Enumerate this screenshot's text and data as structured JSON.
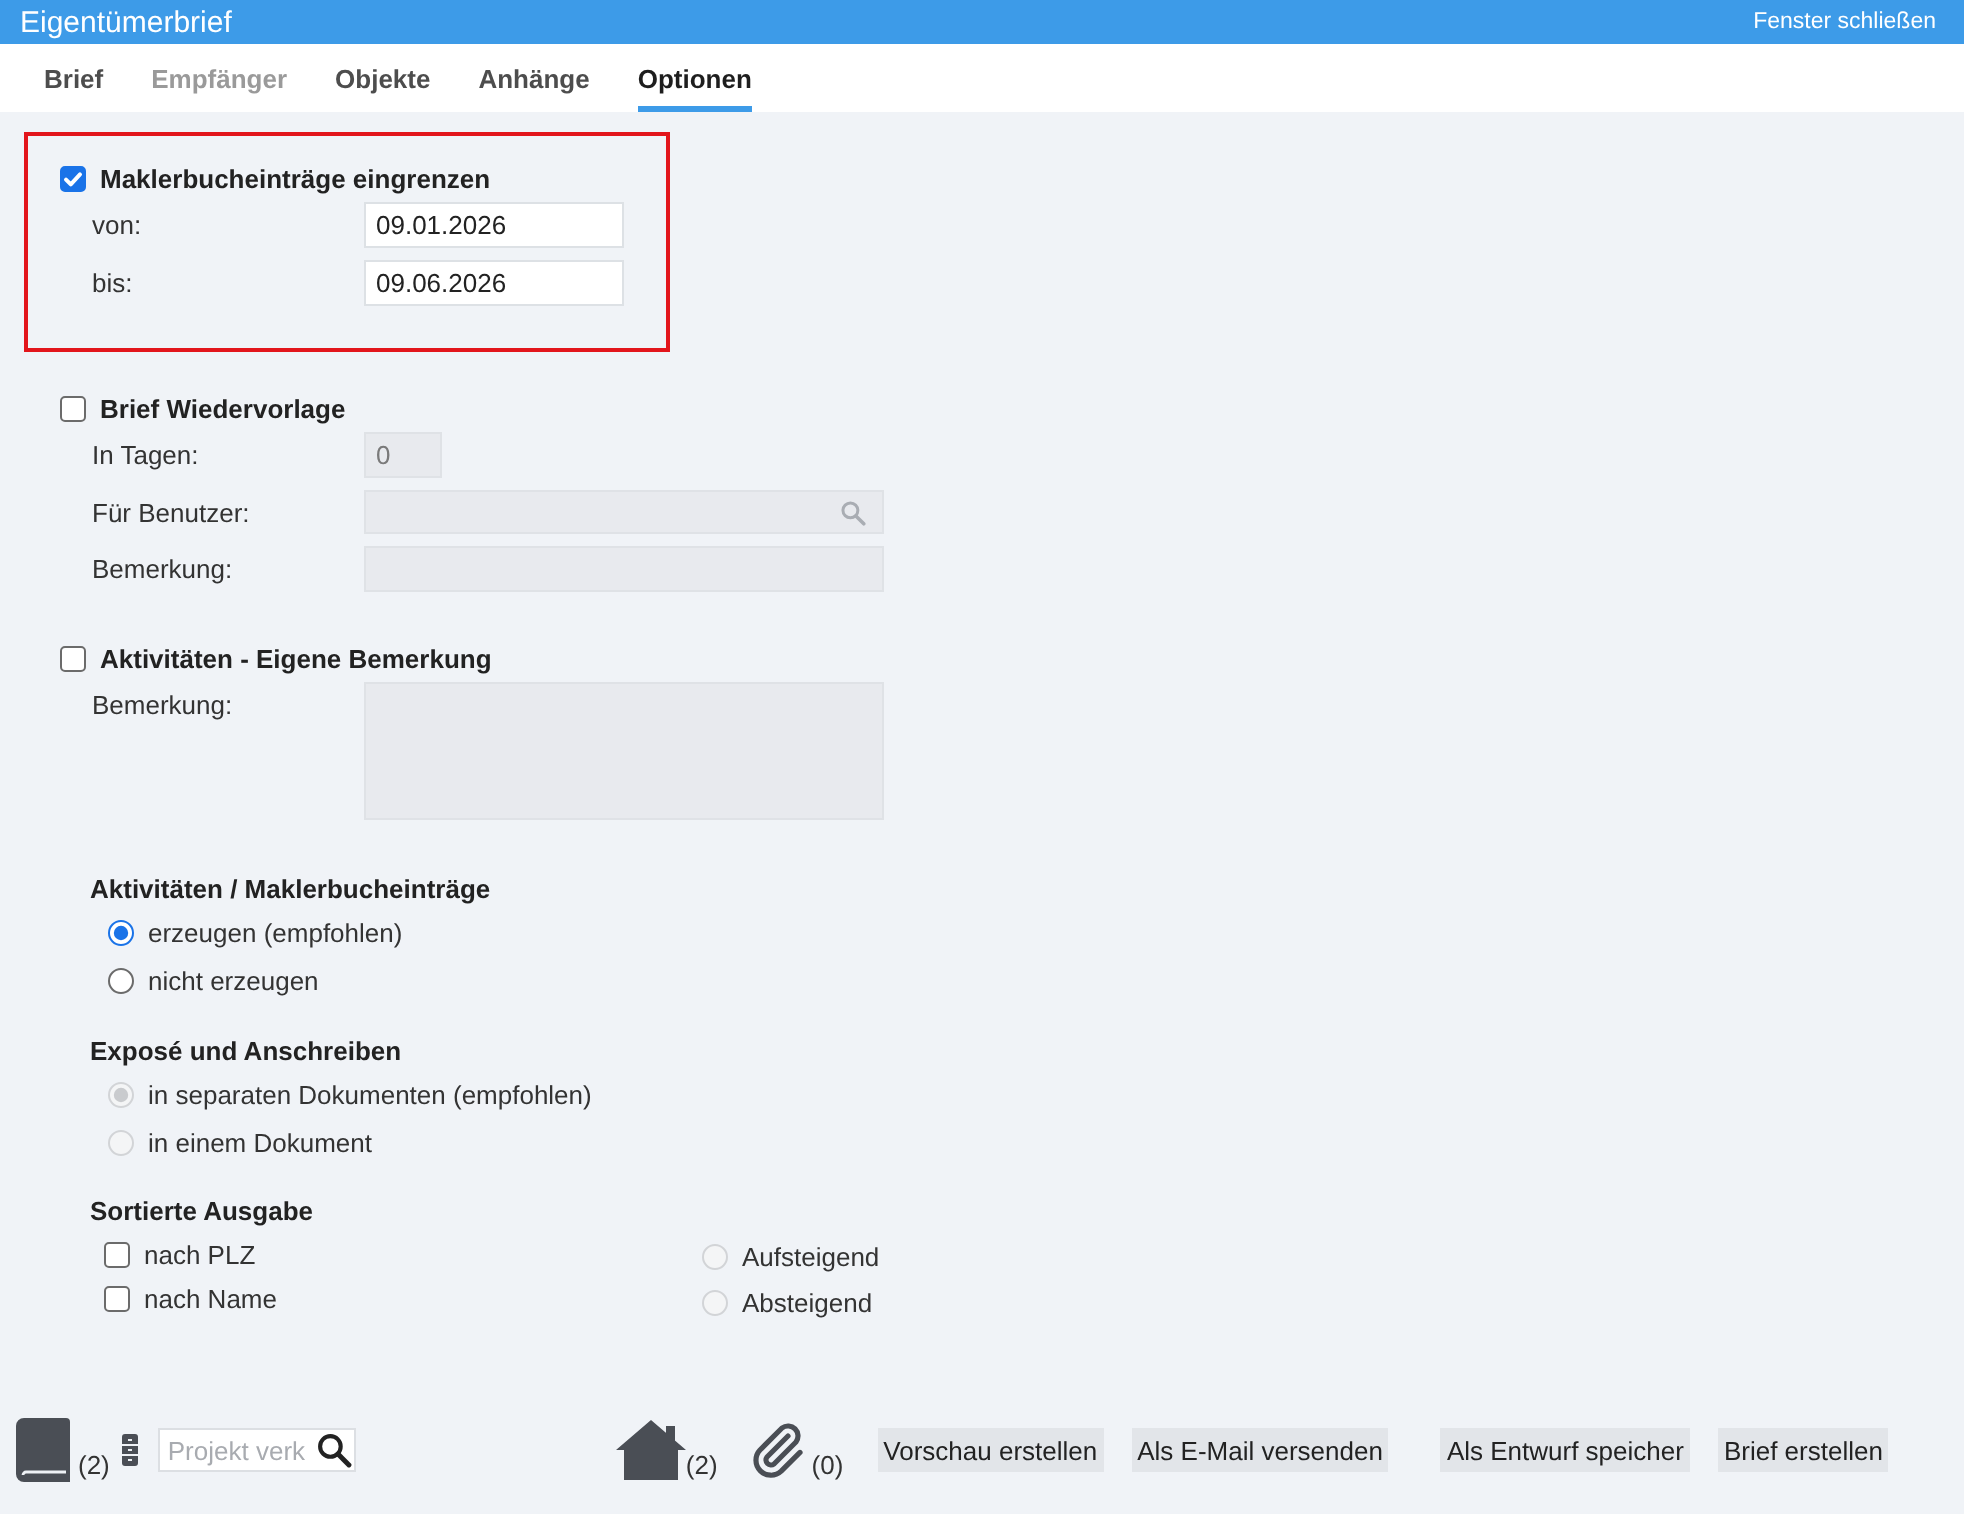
{
  "window": {
    "title": "Eigentümerbrief",
    "close_link": "Fenster schließen"
  },
  "tabs": [
    {
      "label": "Brief",
      "selected": false,
      "disabled": false
    },
    {
      "label": "Empfänger",
      "selected": false,
      "disabled": true
    },
    {
      "label": "Objekte",
      "selected": false,
      "disabled": false
    },
    {
      "label": "Anhänge",
      "selected": false,
      "disabled": false
    },
    {
      "label": "Optionen",
      "selected": true,
      "disabled": false
    }
  ],
  "sections": [
    {
      "kind": "checkbox",
      "label": "Maklerbucheinträge eingrenzen",
      "checked": true,
      "highlighted": true,
      "fields": [
        {
          "label": "von:",
          "kind": "date",
          "value": "09.01.2026",
          "disabled": false
        },
        {
          "label": "bis:",
          "kind": "date",
          "value": "09.06.2026",
          "disabled": false
        }
      ]
    },
    {
      "kind": "checkbox",
      "label": "Brief Wiedervorlage",
      "checked": false,
      "fields": [
        {
          "label": "In Tagen:",
          "kind": "number",
          "value": "0",
          "disabled": true
        },
        {
          "label": "Für Benutzer:",
          "kind": "search",
          "disabled": true
        },
        {
          "label": "Bemerkung:",
          "kind": "text",
          "disabled": true
        }
      ]
    },
    {
      "kind": "checkbox",
      "label": "Aktivitäten - Eigene Bemerkung",
      "checked": false,
      "fields": [
        {
          "label": "Bemerkung:",
          "kind": "textarea",
          "disabled": true
        }
      ]
    },
    {
      "kind": "radio",
      "title": "Aktivitäten / Maklerbucheinträge",
      "options": [
        {
          "label": "erzeugen (empfohlen)",
          "selected": true,
          "disabled": false
        },
        {
          "label": "nicht erzeugen",
          "selected": false,
          "disabled": false
        }
      ]
    },
    {
      "kind": "radio",
      "title": "Exposé und Anschreiben",
      "options": [
        {
          "label": "in separaten Dokumenten (empfohlen)",
          "selected": true,
          "disabled": true
        },
        {
          "label": "in einem Dokument",
          "selected": false,
          "disabled": true
        }
      ]
    },
    {
      "kind": "sort",
      "title": "Sortierte Ausgabe",
      "checkboxes": [
        {
          "label": "nach PLZ",
          "checked": false
        },
        {
          "label": "nach Name",
          "checked": false
        }
      ],
      "options": [
        {
          "label": "Aufsteigend",
          "selected": false,
          "disabled": true
        },
        {
          "label": "Absteigend",
          "selected": false,
          "disabled": true
        }
      ]
    }
  ],
  "footer": {
    "book_count": "(2)",
    "project_search": {
      "placeholder": "Projekt verk"
    },
    "house_count": "(2)",
    "paperclip_count": "(0)",
    "buttons": [
      "Vorschau erstellen",
      "Als E-Mail versenden",
      "Als Entwurf speicher",
      "Brief erstellen"
    ]
  }
}
